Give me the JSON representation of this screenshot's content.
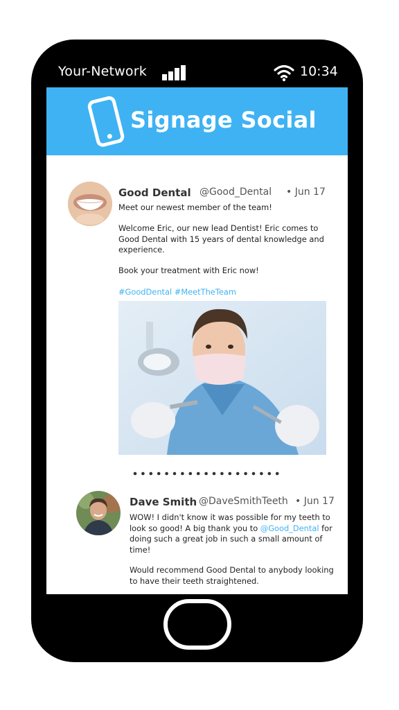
{
  "status_bar": {
    "network": "Your-Network",
    "time": "10:34",
    "signal_icon": "signal-bars-icon",
    "wifi_icon": "wifi-icon"
  },
  "header": {
    "title": "Signage Social",
    "icon": "smartphone-icon",
    "background_color": "#3fb2f3"
  },
  "posts": [
    {
      "name": "Good Dental",
      "handle": "@Good_Dental",
      "date": "• Jun 17",
      "lines": [
        "Meet our newest member of the team!",
        "Welcome Eric, our new lead Dentist! Eric comes to Good Dental with 15 years of dental knowledge and experience.",
        "Book your treatment with Eric now!"
      ],
      "hashtags": "#GoodDental #MeetTheTeam",
      "image": "dentist-photo"
    },
    {
      "name": "Dave Smith",
      "handle": "@DaveSmithTeeth",
      "date": "• Jun 17",
      "text_before_mention": "WOW! I didn't know it was possible for my teeth to look so good! A big thank you to ",
      "mention": "@Good_Dental",
      "text_after_mention": " for doing such a great job in such a small amount of time!",
      "text_second": "Would recommend Good Dental to anybody looking to have their teeth straightened."
    }
  ],
  "accent_color": "#3fb2f3"
}
